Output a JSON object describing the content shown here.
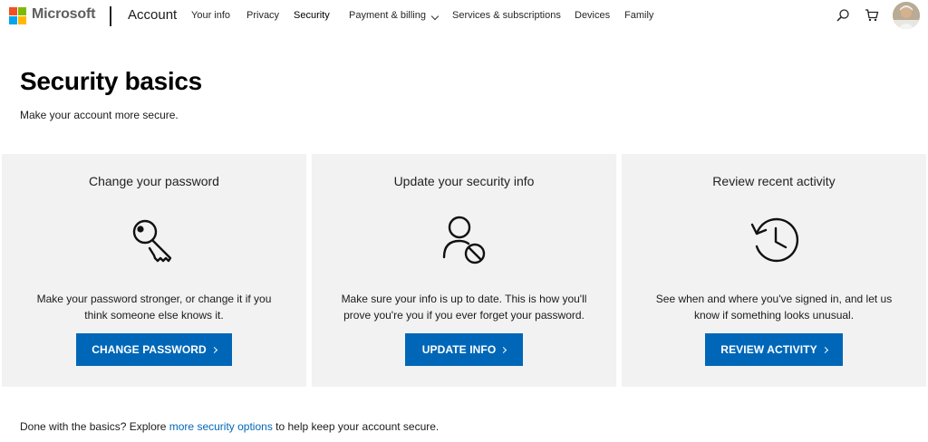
{
  "header": {
    "brand": "Microsoft",
    "account": "Account",
    "nav": [
      "Your info",
      "Privacy",
      "Security",
      "Payment & billing",
      "Services & subscriptions",
      "Devices",
      "Family"
    ],
    "active_nav": "Security",
    "icons": [
      "search-icon",
      "cart-icon",
      "avatar"
    ]
  },
  "logo_colors": [
    "#f25022",
    "#7fba00",
    "#00a4ef",
    "#ffb900"
  ],
  "page": {
    "title": "Security basics",
    "subtitle": "Make your account more secure."
  },
  "cards": [
    {
      "title": "Change your password",
      "icon": "key-icon",
      "desc1": "Make your password stronger, or change it if you",
      "desc2": "think someone else knows it.",
      "button": "CHANGE PASSWORD"
    },
    {
      "title": "Update your security info",
      "icon": "user-blocked-icon",
      "desc1": "Make sure your info is up to date. This is how you'll",
      "desc2": "prove you're you if you ever forget your password.",
      "button": "UPDATE INFO"
    },
    {
      "title": "Review recent activity",
      "icon": "history-clock-icon",
      "desc1": "See when and where you've signed in, and let us",
      "desc2": "know if something looks unusual.",
      "button": "REVIEW ACTIVITY"
    }
  ],
  "footer": {
    "before": "Done with the basics? Explore ",
    "link": "more security options",
    "after": " to help keep your account secure."
  },
  "colors": {
    "accent": "#0067b8",
    "card_bg": "#f2f2f2"
  }
}
